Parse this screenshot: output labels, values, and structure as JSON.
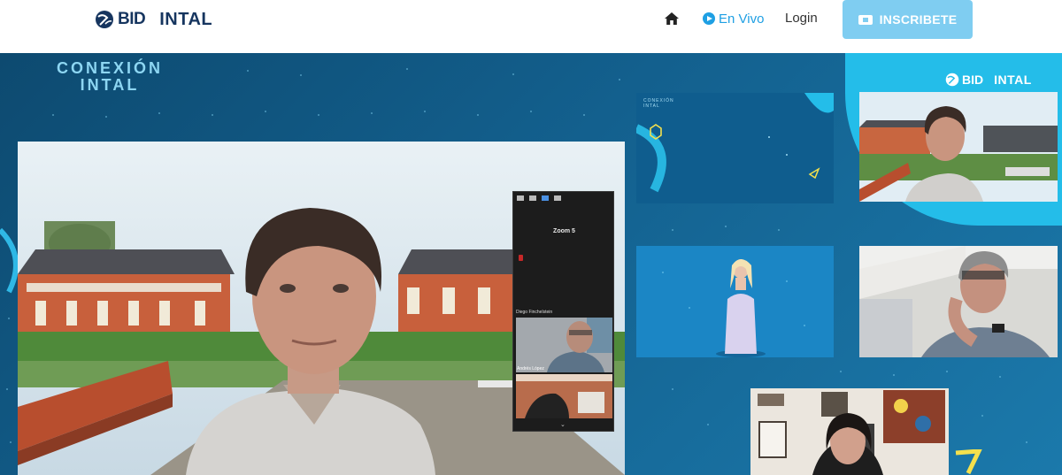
{
  "header": {
    "logo_bid": "BID",
    "logo_intal": "INTAL",
    "nav": {
      "home_icon": "home-icon",
      "live_label": "En Vivo",
      "live_icon": "play-circle-icon",
      "login_label": "Login",
      "cta_label": "INSCRIBETE",
      "cta_icon": "ticket-icon"
    }
  },
  "stream": {
    "brand_line1": "CONEXIÓN",
    "brand_line2": "INTAL",
    "overlay_logo_bid": "BID",
    "overlay_logo_intal": "INTAL",
    "zoom_panel": {
      "title": "Zoom 5",
      "participant_1": "Diego Finchelstein",
      "participant_2": "Andrés López"
    },
    "slide_tile": {
      "title_line1": "CONEXIÓN",
      "title_line2": "INTAL"
    }
  },
  "colors": {
    "brand_navy": "#16355f",
    "live_blue": "#1e9fe3",
    "cta_bg": "#7fcdf1",
    "accent_cyan": "#24bde9",
    "accent_yellow": "#f4e04d"
  }
}
